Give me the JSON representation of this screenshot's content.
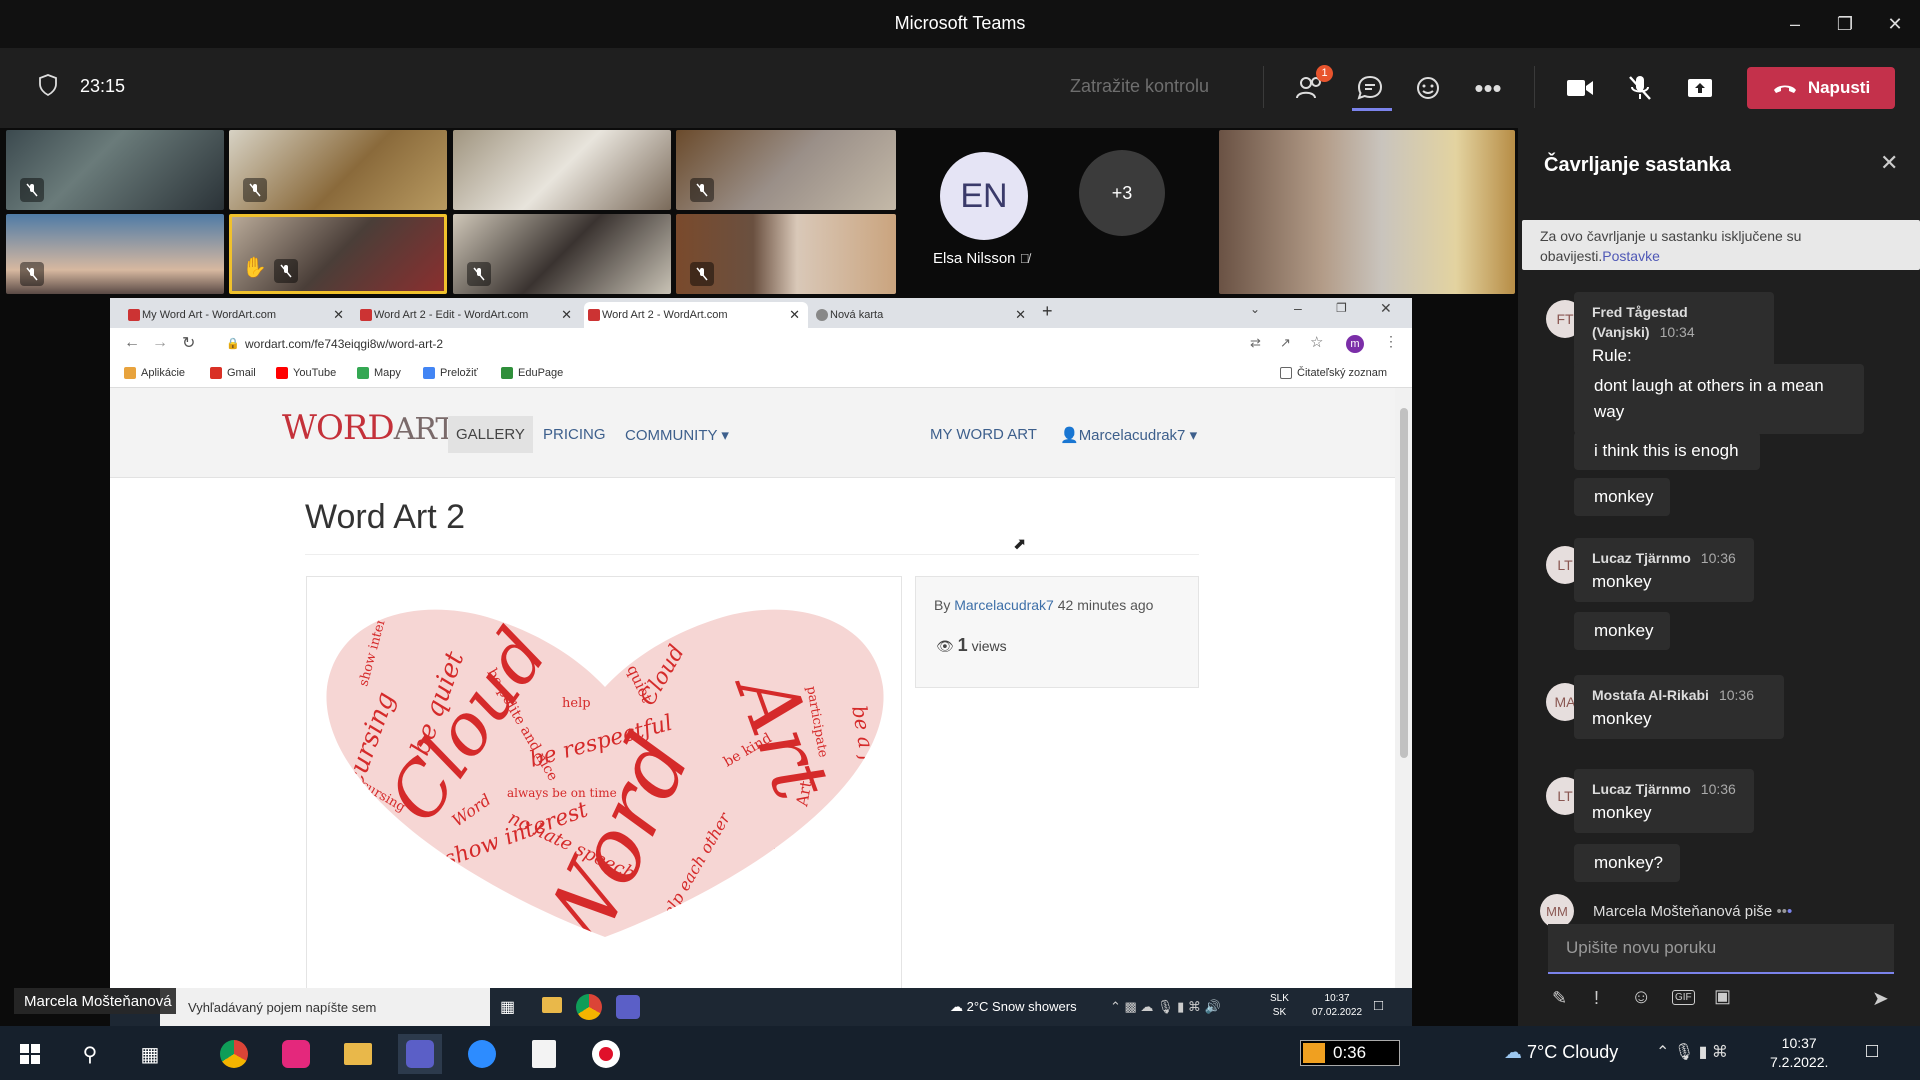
{
  "window": {
    "title": "Microsoft Teams"
  },
  "toolbar": {
    "timer": "23:15",
    "request_control": "Zatražite kontrolu",
    "participants_badge": "1",
    "leave_label": "Napusti"
  },
  "participants": {
    "en_initials": "EN",
    "en_name": "Elsa Nilsson",
    "more_count": "+3",
    "presenter_name": "Marcela Mošteňanová"
  },
  "browser": {
    "tabs": [
      "My Word Art - WordArt.com",
      "Word Art 2 - Edit - WordArt.com",
      "Word Art 2 - WordArt.com",
      "Nová karta"
    ],
    "url": "wordart.com/fe743eiqgi8w/word-art-2",
    "bookmarks": [
      "Aplikácie",
      "Gmail",
      "YouTube",
      "Mapy",
      "Preložiť",
      "EduPage"
    ],
    "reading_list": "Čitateľský zoznam",
    "profile_initial": "m"
  },
  "site": {
    "logo_a": "WORD",
    "logo_b": "ART",
    "nav": [
      "GALLERY",
      "PRICING",
      "COMMUNITY ▾"
    ],
    "my_word_art": "MY WORD ART",
    "user": "Marcelacudrak7",
    "page_title": "Word Art 2",
    "by": "By",
    "author": "Marcelacudrak7",
    "ago": "42 minutes ago",
    "views_count": "1",
    "views_label": "views"
  },
  "wordcloud": {
    "big": [
      "Cloud",
      "Word",
      "Art"
    ],
    "phrases": [
      "no cursing",
      "be quiet",
      "be polite and nice",
      "be respectful",
      "show interest",
      "no hate speech",
      "be kind",
      "be a friend",
      "help each other",
      "Cloud",
      "Word",
      "Art",
      "participate",
      "show interest",
      "no cursing",
      "always be on time",
      "be quiet",
      "be kind",
      "help",
      "Art"
    ]
  },
  "inner_taskbar": {
    "search": "Vyhľadávaný pojem napíšte sem",
    "weather": "2°C  Snow showers",
    "lang1": "SLK",
    "lang2": "SK",
    "time": "10:37",
    "date": "07.02.2022"
  },
  "chat": {
    "title": "Čavrljanje sastanka",
    "notice_text": "Za ovo čavrljanje u sastanku isključene su obavijesti.",
    "notice_link": "Postavke",
    "messages": [
      {
        "initials": "FT",
        "sender": "Fred Tågestad (Vanjski)",
        "time": "10:34",
        "lines": [
          "Rule:",
          "dont laugh at others in a mean way",
          "i think this is enogh",
          "monkey"
        ]
      },
      {
        "initials": "LT",
        "sender": "Lucaz Tjärnmo",
        "time": "10:36",
        "lines": [
          "monkey",
          "monkey"
        ]
      },
      {
        "initials": "MA",
        "sender": "Mostafa Al-Rikabi",
        "time": "10:36",
        "lines": [
          "monkey"
        ]
      },
      {
        "initials": "LT",
        "sender": "Lucaz Tjärnmo",
        "time": "10:36",
        "lines": [
          "monkey",
          "monkey?"
        ]
      }
    ],
    "typing_initials": "MM",
    "typing_text": "Marcela Mošteňanová piše",
    "compose_placeholder": "Upišite novu poruku"
  },
  "taskbar": {
    "rec_time": "0:36",
    "weather": "7°C  Cloudy",
    "time": "10:37",
    "date": "7.2.2022."
  },
  "colors": {
    "accent": "#7b83eb",
    "leave": "#c4314b",
    "wordart_red": "#d52a2a"
  }
}
